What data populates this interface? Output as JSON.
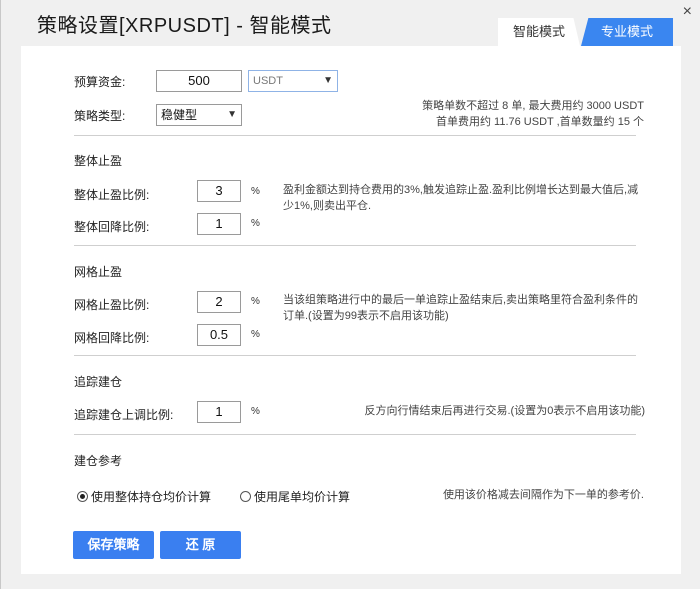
{
  "window": {
    "title": "策略设置[XRPUSDT] - 智能模式",
    "close_glyph": "×"
  },
  "tabs": [
    {
      "label": "智能模式",
      "active": false
    },
    {
      "label": "专业模式",
      "active": true
    }
  ],
  "budget": {
    "label": "预算资金:",
    "value": "500",
    "currency": "USDT"
  },
  "strategy_type": {
    "label": "策略类型:",
    "value": "稳健型"
  },
  "summary": {
    "line1": "策略单数不超过 8 单, 最大费用约 3000 USDT",
    "line2": "首单费用约 11.76 USDT ,首单数量约 15 个"
  },
  "overall_tp": {
    "title": "整体止盈",
    "ratio_label": "整体止盈比例:",
    "ratio_value": "3",
    "pullback_label": "整体回降比例:",
    "pullback_value": "1",
    "desc": "盈利金额达到持仓费用的3%,触发追踪止盈.盈利比例增长达到最大值后,减少1%,则卖出平仓."
  },
  "grid_tp": {
    "title": "网格止盈",
    "ratio_label": "网格止盈比例:",
    "ratio_value": "2",
    "pullback_label": "网格回降比例:",
    "pullback_value": "0.5",
    "desc": "当该组策略进行中的最后一单追踪止盈结束后,卖出策略里符合盈利条件的订单.(设置为99表示不启用该功能)"
  },
  "trailing": {
    "title": "追踪建仓",
    "label": "追踪建仓上调比例:",
    "value": "1",
    "desc": "反方向行情结束后再进行交易.(设置为0表示不启用该功能)"
  },
  "reference": {
    "title": "建仓参考",
    "option1": "使用整体持仓均价计算",
    "option2": "使用尾单均价计算",
    "selected": "option1",
    "desc": "使用该价格减去间隔作为下一单的参考价."
  },
  "percent_sign": "%",
  "buttons": {
    "save": "保存策略",
    "reset": "还 原"
  },
  "colors": {
    "accent": "#3a86f0",
    "button": "#3a7ff0"
  }
}
